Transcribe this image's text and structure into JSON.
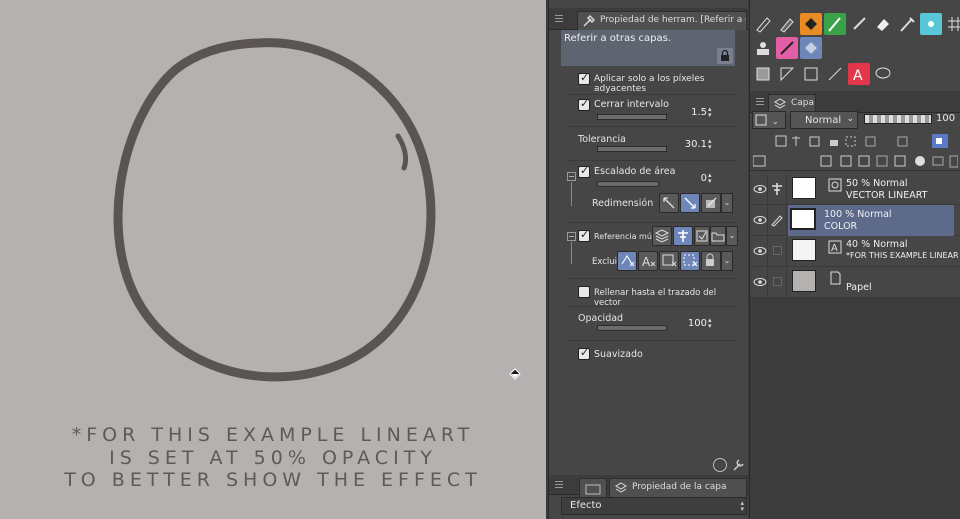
{
  "canvas": {
    "note_lines": [
      "*FOR THIS EXAMPLE LINEART",
      "IS SET AT 50% OPACITY",
      "TO BETTER SHOW THE EFFECT"
    ]
  },
  "tool_property": {
    "tab_title": "Propiedad de herram. [Referir a otras",
    "preset_name": "Referir a otras capas.",
    "options": {
      "adjacent_pixels": "Aplicar solo a los píxeles adyacentes",
      "close_gap": "Cerrar intervalo",
      "close_gap_value": "1.5",
      "tolerance": "Tolerancia",
      "tolerance_value": "30.1",
      "area_scaling": "Escalado de área",
      "area_scaling_value": "0",
      "resize": "Redimensión",
      "multi_ref": "Referencia múlti",
      "exclude": "Excluir",
      "fill_vector": "Rellenar hasta el trazado del vector",
      "opacity": "Opacidad",
      "opacity_value": "100",
      "antialias": "Suavizado"
    },
    "bottom_tab": "Propiedad de la capa",
    "effect_label": "Efecto"
  },
  "layers": {
    "tab_title": "Capa",
    "blend_mode": "Normal",
    "opacity": "100",
    "items": [
      {
        "mode": "50 % Normal",
        "name": "VECTOR LINEART"
      },
      {
        "mode": "100 % Normal",
        "name": "COLOR"
      },
      {
        "mode": "40 % Normal",
        "name": "*FOR THIS EXAMPLE LINEAR"
      },
      {
        "mode": "",
        "name": "Papel"
      }
    ]
  },
  "colors": {
    "canvas_bg": "#b6b1b1",
    "ring": "#5a5553",
    "selection_blue": "#6f86b8"
  }
}
